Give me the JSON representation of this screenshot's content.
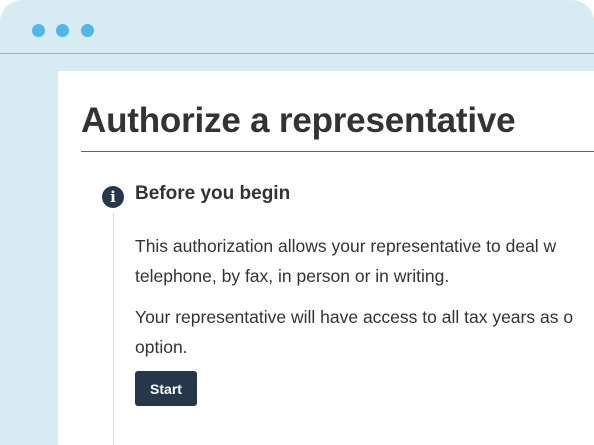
{
  "window": {
    "controls": [
      "window-dot",
      "window-dot",
      "window-dot"
    ],
    "accent_color": "#4fb8e8",
    "frame_color": "#d7ebf3"
  },
  "page": {
    "title": "Authorize a representative",
    "title_rule_color": "#a8493a"
  },
  "alert": {
    "icon": "info-icon",
    "icon_glyph": "i",
    "heading": "Before you begin",
    "paragraph1_line1": "This authorization allows your representative to deal w",
    "paragraph1_line2": "telephone, by fax, in person or in writing.",
    "paragraph2_line1": "Your representative will have access to all tax years as o",
    "paragraph2_line2": "option."
  },
  "actions": {
    "start_label": "Start",
    "button_color": "#26374a"
  }
}
